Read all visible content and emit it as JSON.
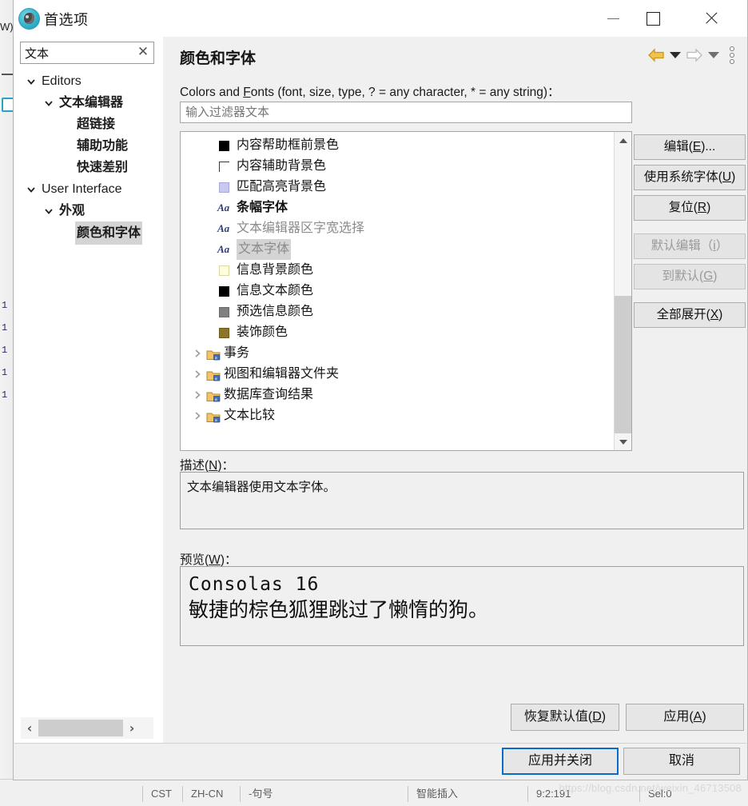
{
  "window": {
    "title": "首选项",
    "icon": "preferences-app-icon",
    "controls": {
      "minimize": "—",
      "maximize": "□",
      "close": "✕"
    }
  },
  "sidebar": {
    "filter": {
      "value": "文本",
      "clear_icon": "✕"
    },
    "items": [
      {
        "label": "Editors",
        "indent": 14,
        "twisty": "down",
        "bold": false,
        "selected": false
      },
      {
        "label": "文本编辑器",
        "indent": 36,
        "twisty": "down",
        "bold": true,
        "selected": false
      },
      {
        "label": "超链接",
        "indent": 58,
        "twisty": "none",
        "bold": true,
        "selected": false
      },
      {
        "label": "辅助功能",
        "indent": 58,
        "twisty": "none",
        "bold": true,
        "selected": false
      },
      {
        "label": "快速差别",
        "indent": 58,
        "twisty": "none",
        "bold": true,
        "selected": false
      },
      {
        "label": "User Interface",
        "indent": 14,
        "twisty": "down",
        "bold": false,
        "selected": false
      },
      {
        "label": "外观",
        "indent": 36,
        "twisty": "down",
        "bold": true,
        "selected": false
      },
      {
        "label": "颜色和字体",
        "indent": 58,
        "twisty": "none",
        "bold": true,
        "selected": true
      }
    ],
    "hscroll": {
      "left_icon": "‹",
      "right_icon": "›"
    }
  },
  "pane": {
    "title": "颜色和字体",
    "nav": {
      "back_icon": "back-arrow-icon",
      "back_dropdown_icon": "chevron-down-icon",
      "forward_icon": "forward-arrow-icon",
      "forward_dropdown_icon": "chevron-down-icon",
      "menu_icon": "vertical-dots-icon"
    },
    "fields_label_before": "Colors and ",
    "fields_label_mnemonic": "F",
    "fields_label_after": "onts (font, size, type, ? = any character, * = any string)：",
    "filter_placeholder": "输入过滤器文本",
    "filter_value": ""
  },
  "list": {
    "rows": [
      {
        "kind": "color",
        "label": "内容帮助框前景色",
        "color": "#000000",
        "filled": true,
        "bold": false,
        "gray": false,
        "selected": false
      },
      {
        "kind": "color",
        "label": "内容辅助背景色",
        "color": "#ffffff",
        "filled": false,
        "bold": false,
        "gray": false,
        "selected": false
      },
      {
        "kind": "color",
        "label": "匹配高亮背景色",
        "color": "#c8c8f0",
        "filled": true,
        "bold": false,
        "gray": false,
        "selected": false
      },
      {
        "kind": "font",
        "label": "条幅字体",
        "icon": "Aa",
        "bold": true,
        "gray": false,
        "selected": false
      },
      {
        "kind": "font",
        "label": "文本编辑器区字宽选择",
        "icon": "Aa",
        "bold": false,
        "gray": true,
        "selected": false
      },
      {
        "kind": "font",
        "label": "文本字体",
        "icon": "Aa",
        "bold": false,
        "gray": true,
        "selected": true
      },
      {
        "kind": "color",
        "label": "信息背景颜色",
        "color": "#fdfde0",
        "filled": true,
        "bold": false,
        "gray": false,
        "selected": false
      },
      {
        "kind": "color",
        "label": "信息文本颜色",
        "color": "#000000",
        "filled": true,
        "bold": false,
        "gray": false,
        "selected": false
      },
      {
        "kind": "color",
        "label": "预选信息颜色",
        "color": "#808080",
        "filled": true,
        "bold": false,
        "gray": false,
        "selected": false
      },
      {
        "kind": "color",
        "label": "装饰颜色",
        "color": "#8c7526",
        "filled": true,
        "bold": false,
        "gray": false,
        "selected": false
      },
      {
        "kind": "node",
        "label": "事务",
        "twisty": "right",
        "icon": "folder-icon"
      },
      {
        "kind": "node",
        "label": "视图和编辑器文件夹",
        "twisty": "right",
        "icon": "folder-icon"
      },
      {
        "kind": "node",
        "label": "数据库查询结果",
        "twisty": "right",
        "icon": "folder-icon"
      },
      {
        "kind": "node",
        "label": "文本比较",
        "twisty": "right",
        "icon": "folder-icon"
      }
    ],
    "scroll": {
      "up_icon": "chevron-up-icon",
      "down_icon": "chevron-down-icon"
    }
  },
  "side_buttons": [
    {
      "before": "编辑(",
      "mnemonic": "E",
      "after": ")...",
      "disabled": false,
      "name": "edit-button"
    },
    {
      "before": "使用系统字体(",
      "mnemonic": "U",
      "after": ")",
      "disabled": false,
      "name": "use-system-font-button"
    },
    {
      "before": "复位(",
      "mnemonic": "R",
      "after": ")",
      "disabled": false,
      "name": "reset-button"
    },
    {
      "before": "默认编辑（",
      "mnemonic": "i",
      "after": "）",
      "disabled": true,
      "name": "edit-default-button"
    },
    {
      "before": "到默认(",
      "mnemonic": "G",
      "after": ")",
      "disabled": true,
      "name": "go-to-default-button"
    },
    {
      "before": "全部展开(",
      "mnemonic": "X",
      "after": ")",
      "disabled": false,
      "name": "expand-all-button"
    }
  ],
  "description": {
    "label_before": "描述(",
    "label_mnemonic": "N",
    "label_after": ")：",
    "text": "文本编辑器使用文本字体。"
  },
  "preview": {
    "label_before": "预览(",
    "label_mnemonic": "W",
    "label_after": ")：",
    "line1": "Consolas 16",
    "line2": "敏捷的棕色狐狸跳过了懒惰的狗。"
  },
  "pane_buttons": [
    {
      "before": "恢复默认值(",
      "mnemonic": "D",
      "after": ")",
      "name": "restore-defaults-button"
    },
    {
      "before": "应用(",
      "mnemonic": "A",
      "after": ")",
      "name": "apply-button"
    }
  ],
  "footer_buttons": [
    {
      "label": "应用并关闭",
      "primary": true,
      "name": "apply-and-close-button"
    },
    {
      "label": "取消",
      "primary": false,
      "name": "cancel-button"
    }
  ],
  "background": {
    "line_numbers": [
      "1",
      "1",
      "1",
      "1",
      "1"
    ],
    "wj_text": "W)",
    "status_segments": [
      "CST",
      "ZH-CN",
      "-句号",
      "智能插入",
      "9:2:191",
      "Sel:0"
    ],
    "watermark": "https://blog.csdn.net/weixin_46713508"
  },
  "colors": {
    "accent": "#0a6cc4",
    "dialog_bg": "#f0f0f0",
    "selection": "#d4d4d4",
    "back_arrow": "#e8b02a"
  }
}
